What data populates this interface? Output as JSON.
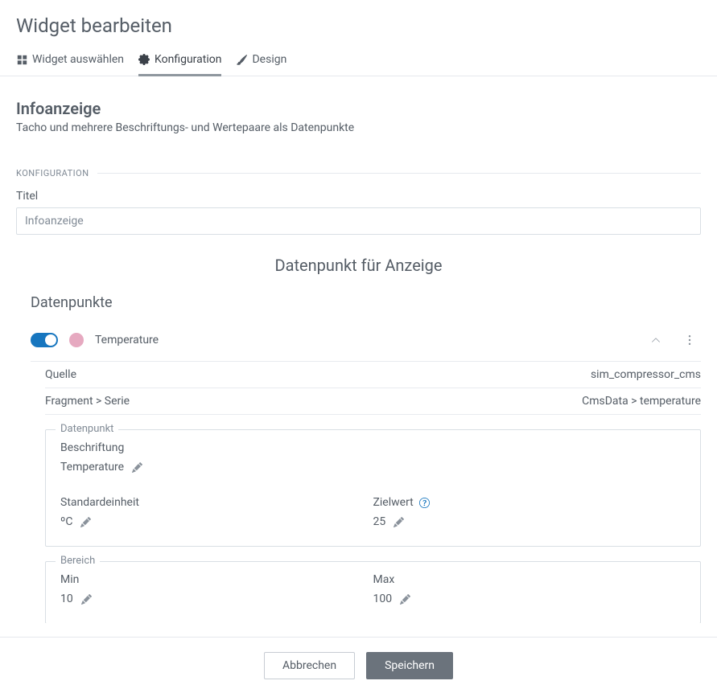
{
  "page_title": "Widget bearbeiten",
  "tabs": [
    {
      "label": "Widget auswählen"
    },
    {
      "label": "Konfiguration"
    },
    {
      "label": "Design"
    }
  ],
  "widget": {
    "name": "Infoanzeige",
    "description": "Tacho und mehrere Beschriftungs- und Wertepaare als Datenpunkte"
  },
  "config_section_label": "KONFIGURATION",
  "title_field": {
    "label": "Titel",
    "value": "Infoanzeige"
  },
  "gauge_section_title": "Datenpunkt für Anzeige",
  "datapoints_heading": "Datenpunkte",
  "datapoint": {
    "color": "#e6a9c0",
    "label": "Temperature",
    "source_label": "Quelle",
    "source_value": "sim_compressor_cms",
    "fragment_label": "Fragment > Serie",
    "fragment_value": "CmsData > temperature",
    "dp_fieldset_legend": "Datenpunkt",
    "caption_label": "Beschriftung",
    "caption_value": "Temperature",
    "unit_label": "Standardeinheit",
    "unit_value": "ºC",
    "target_label": "Zielwert",
    "target_value": "25",
    "range_fieldset_legend": "Bereich",
    "min_label": "Min",
    "min_value": "10",
    "max_label": "Max",
    "max_value": "100"
  },
  "footer": {
    "cancel": "Abbrechen",
    "save": "Speichern"
  }
}
